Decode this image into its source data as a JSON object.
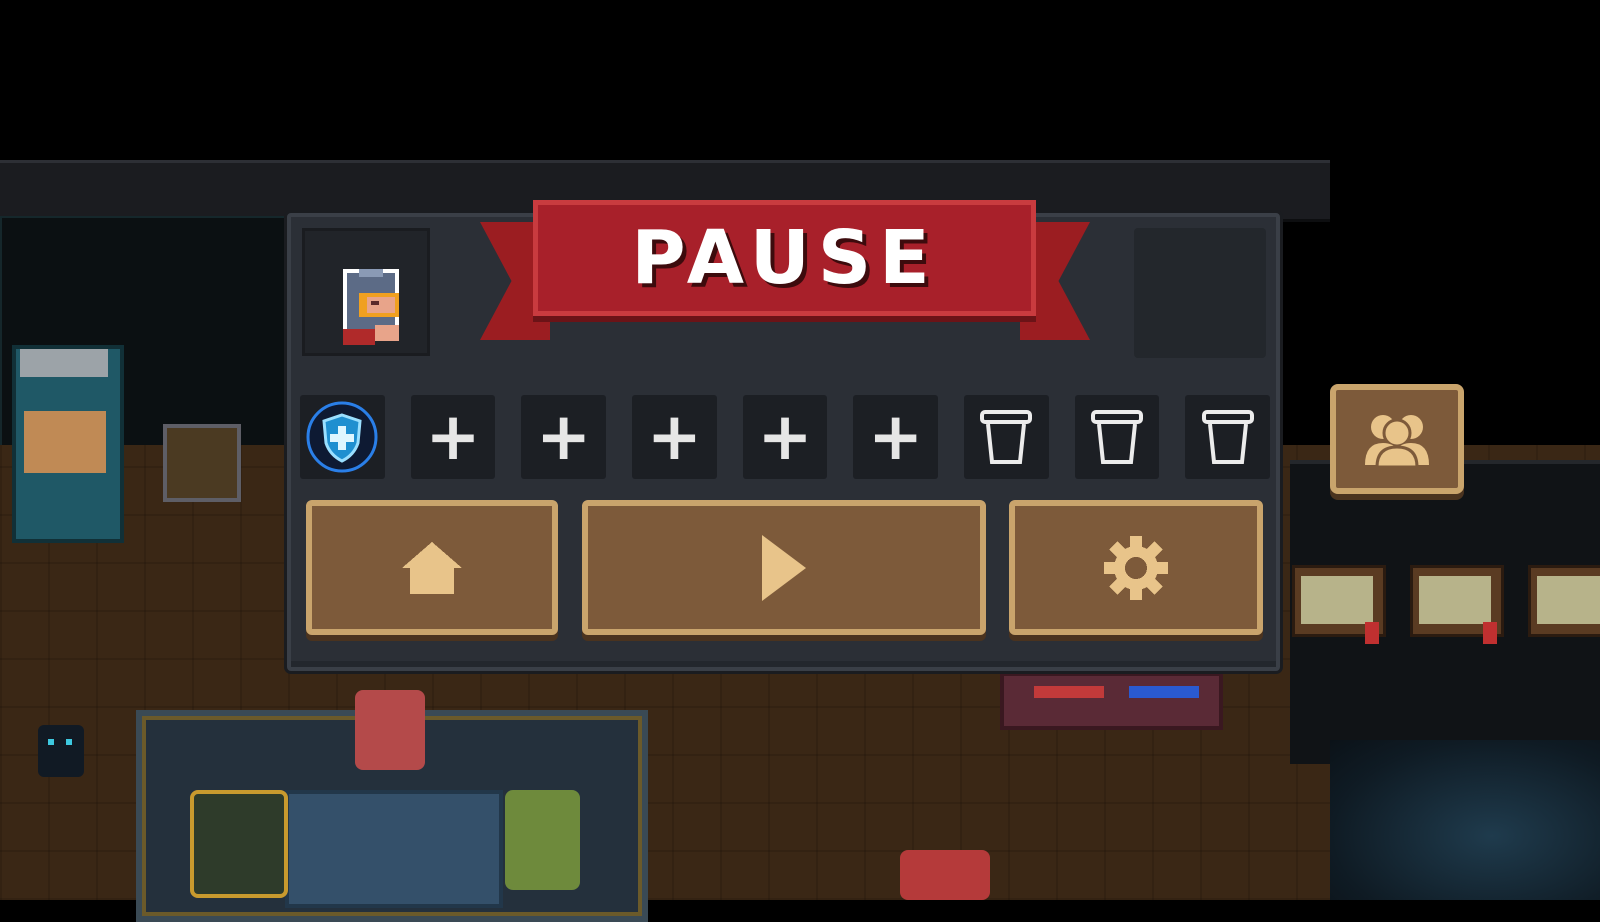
{
  "pause_menu": {
    "title": "PAUSE",
    "buff_slots": [
      {
        "type": "buff",
        "icon": "shield-cross-icon",
        "label": ""
      },
      {
        "type": "add",
        "icon": "plus-icon",
        "label": "+"
      },
      {
        "type": "add",
        "icon": "plus-icon",
        "label": "+"
      },
      {
        "type": "add",
        "icon": "plus-icon",
        "label": "+"
      },
      {
        "type": "add",
        "icon": "plus-icon",
        "label": "+"
      },
      {
        "type": "add",
        "icon": "plus-icon",
        "label": "+"
      },
      {
        "type": "empty",
        "icon": "cup-icon",
        "label": ""
      },
      {
        "type": "empty",
        "icon": "cup-icon",
        "label": ""
      },
      {
        "type": "empty",
        "icon": "cup-icon",
        "label": ""
      }
    ],
    "buttons": {
      "home": "home-icon",
      "resume": "play-icon",
      "settings": "gear-icon"
    }
  },
  "side": {
    "party_button": "party-icon"
  },
  "colors": {
    "banner_red": "#a8202a",
    "button_brown": "#7d5a3a",
    "button_border": "#c9a46c",
    "panel_bg": "#2b2f36"
  }
}
